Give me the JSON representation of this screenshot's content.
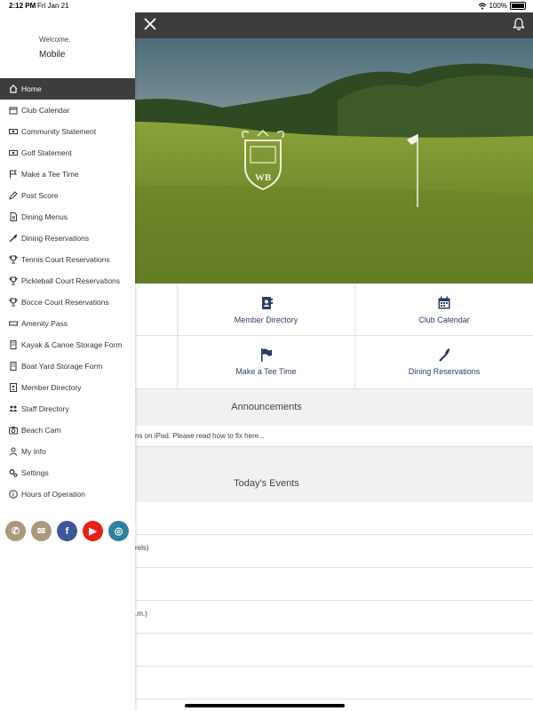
{
  "status_bar": {
    "time": "2:12 PM",
    "date": "Fri Jan 21",
    "battery": "100%"
  },
  "drawer": {
    "welcome": "Welcome,",
    "user_name": "Mobile",
    "menu": [
      {
        "label": "Home",
        "icon": "home-icon",
        "active": true
      },
      {
        "label": "Club Calendar",
        "icon": "calendar-icon"
      },
      {
        "label": "Community Statement",
        "icon": "money-icon"
      },
      {
        "label": "Golf Statement",
        "icon": "money-icon"
      },
      {
        "label": "Make a Tee Time",
        "icon": "flag-icon"
      },
      {
        "label": "Post Score",
        "icon": "pencil-icon"
      },
      {
        "label": "Dining Menus",
        "icon": "document-icon"
      },
      {
        "label": "Dining Reservations",
        "icon": "utensils-icon"
      },
      {
        "label": "Tennis Court Reservations",
        "icon": "trophy-icon"
      },
      {
        "label": "Pickleball Court Reservations",
        "icon": "trophy-icon"
      },
      {
        "label": "Bocce Court Reservations",
        "icon": "trophy-icon"
      },
      {
        "label": "Amenity Pass",
        "icon": "ticket-icon"
      },
      {
        "label": "Kayak & Canoe Storage Form",
        "icon": "building-icon"
      },
      {
        "label": "Boat Yard Storage Form",
        "icon": "building-icon"
      },
      {
        "label": "Member Directory",
        "icon": "address-book-icon"
      },
      {
        "label": "Staff Directory",
        "icon": "users-icon"
      },
      {
        "label": "Beach Cam",
        "icon": "camera-icon"
      },
      {
        "label": "My Info",
        "icon": "user-icon"
      },
      {
        "label": "Settings",
        "icon": "gears-icon"
      },
      {
        "label": "Hours of Operation",
        "icon": "info-icon"
      }
    ],
    "social": [
      {
        "name": "phone-icon",
        "glyph": "✆",
        "color": "#a99a7c"
      },
      {
        "name": "email-icon",
        "glyph": "✉",
        "color": "#a99a7c"
      },
      {
        "name": "facebook-icon",
        "glyph": "f",
        "color": "#3b5998"
      },
      {
        "name": "youtube-icon",
        "glyph": "▶",
        "color": "#e62117"
      },
      {
        "name": "instagram-icon",
        "glyph": "◎",
        "color": "#2f7f9f"
      }
    ]
  },
  "hero": {
    "logo_text": "WB"
  },
  "tiles": [
    {
      "label": "",
      "icon": ""
    },
    {
      "label": "Member Directory",
      "icon": "address-book-icon"
    },
    {
      "label": "Club Calendar",
      "icon": "calendar-icon"
    },
    {
      "label": "",
      "icon": ""
    },
    {
      "label": "Make a Tee Time",
      "icon": "flag-icon"
    },
    {
      "label": "Dining Reservations",
      "icon": "utensils-icon"
    }
  ],
  "announcements": {
    "heading": "Announcements",
    "text": "ns on iPad. Please read how to fix here..."
  },
  "events": {
    "heading": "Today's Events",
    "rows": [
      "",
      "rels)",
      "",
      ".m.)",
      "",
      ""
    ]
  },
  "colors": {
    "header": "#3d3d3d",
    "accent_navy": "#2b3d66",
    "gold": "#a99a7c"
  }
}
